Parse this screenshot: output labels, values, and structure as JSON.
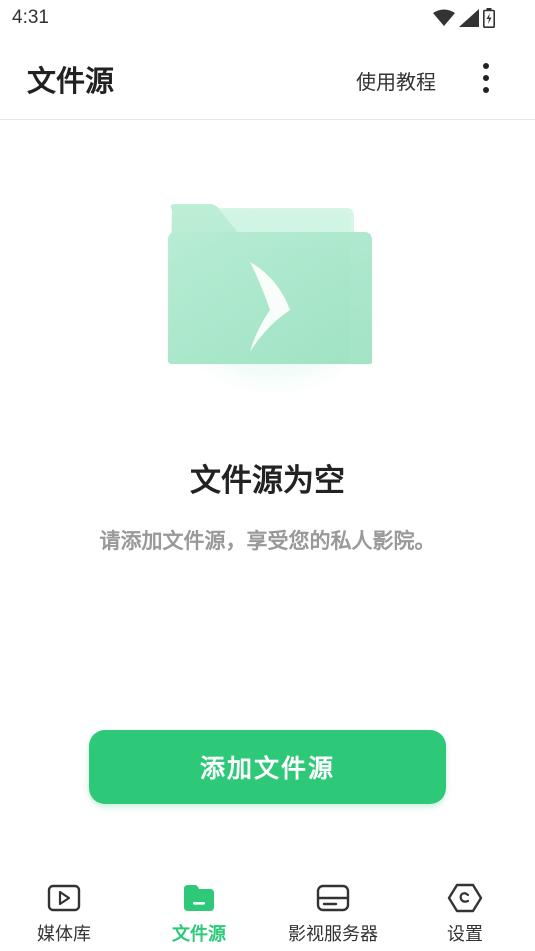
{
  "status_bar": {
    "time": "4:31",
    "icons": [
      "wifi-icon",
      "signal-icon",
      "battery-icon"
    ]
  },
  "app_bar": {
    "title": "文件源",
    "tutorial_label": "使用教程",
    "more_icon": "more-vertical-icon"
  },
  "empty_state": {
    "illustration_icon": "folder-play-icon",
    "title": "文件源为空",
    "description": "请添加文件源，享受您的私人影院。"
  },
  "add_button": {
    "label": "添加文件源"
  },
  "bottom_nav": {
    "items": [
      {
        "label": "媒体库",
        "icon": "media-library-icon",
        "active": false
      },
      {
        "label": "文件源",
        "icon": "folder-icon",
        "active": true
      },
      {
        "label": "影视服务器",
        "icon": "server-icon",
        "active": false
      },
      {
        "label": "设置",
        "icon": "settings-icon",
        "active": false
      }
    ]
  },
  "colors": {
    "accent": "#2dc979",
    "text_primary": "#222222",
    "text_secondary": "#999999",
    "illustration": "#a8e8c8"
  }
}
